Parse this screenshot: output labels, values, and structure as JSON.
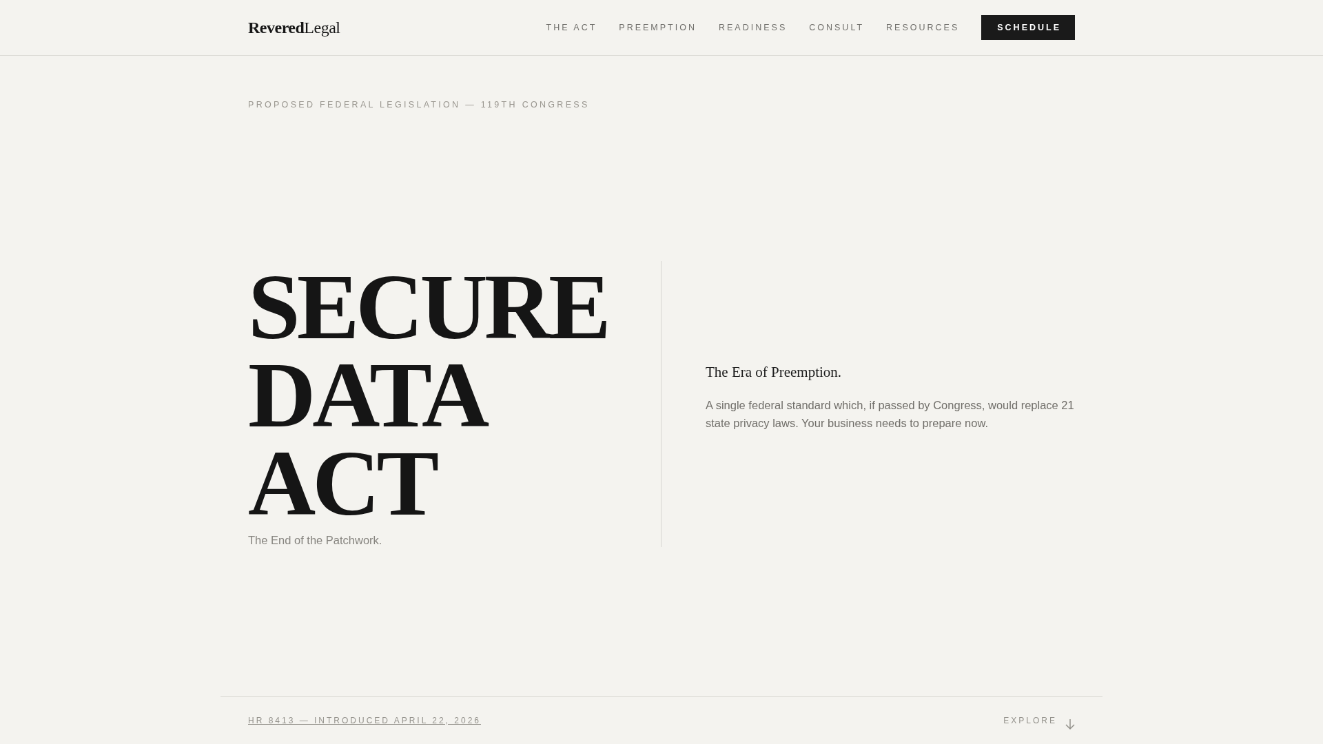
{
  "header": {
    "logo": {
      "bold": "Revered",
      "regular": "Legal"
    },
    "nav": [
      "THE ACT",
      "PREEMPTION",
      "READINESS",
      "CONSULT",
      "RESOURCES"
    ],
    "cta": "SCHEDULE"
  },
  "hero": {
    "eyebrow": "PROPOSED FEDERAL LEGISLATION — 119TH CONGRESS",
    "title_lines": [
      "SECURE",
      "DATA",
      "ACT"
    ],
    "subtitle": "The End of the Patchwork.",
    "aside_heading": "The Era of Preemption.",
    "aside_text": "A single federal standard which, if passed by Congress, would replace 21 state privacy laws. Your business needs to prepare now."
  },
  "footer": {
    "bill_link": "HR 8413 — INTRODUCED APRIL 22, 2026",
    "explore": "EXPLORE"
  }
}
